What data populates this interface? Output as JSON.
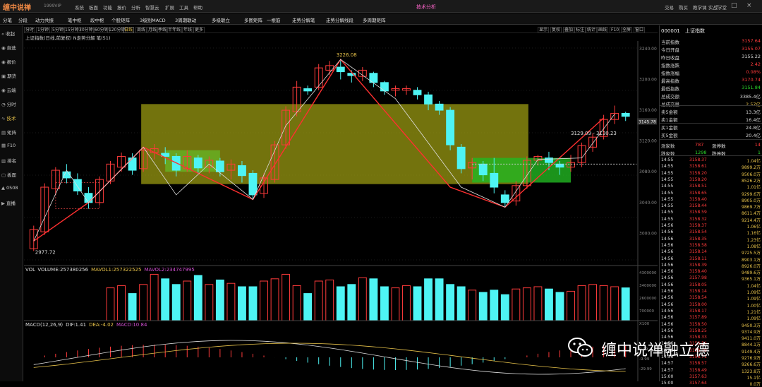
{
  "app": {
    "logo": "缠中说禅",
    "version": "1999VIP",
    "title": "技术分析"
  },
  "menu": [
    "系统",
    "板面",
    "功能",
    "报价",
    "分析",
    "智慧云",
    "扩展",
    "工具",
    "帮助"
  ],
  "right_menu": [
    "交易",
    "购买",
    "教学课",
    "实战学堂"
  ],
  "toolbar": [
    "分笔",
    "分段",
    "动力共振",
    "笔中枢",
    "段中枢",
    "个股矩阵",
    "3级别MACD",
    "3周期联动",
    "多级联立",
    "多图矩阵",
    "一根筋",
    "走势分解笔",
    "走势分解线段",
    "多周期矩阵"
  ],
  "sidebar": [
    {
      "icon": "«",
      "label": "收起"
    },
    {
      "icon": "◉",
      "label": "自选"
    },
    {
      "icon": "◉",
      "label": "报价"
    },
    {
      "icon": "▣",
      "label": "期货"
    },
    {
      "icon": "◉",
      "label": "云端"
    },
    {
      "icon": "◔",
      "label": "分时"
    },
    {
      "icon": "∿",
      "label": "技术"
    },
    {
      "icon": "▤",
      "label": "矩阵"
    },
    {
      "icon": "▦",
      "label": "F10"
    },
    {
      "icon": "▥",
      "label": "排名"
    },
    {
      "icon": "▢",
      "label": "板面"
    },
    {
      "icon": "▲",
      "label": "0508"
    },
    {
      "icon": "▶",
      "label": "直播"
    }
  ],
  "periods": [
    "分时",
    "1分钟",
    "5分钟",
    "15分钟",
    "30分钟",
    "60分钟",
    "120分钟",
    "日线",
    "周线",
    "月线",
    "季线",
    "半年线",
    "年线",
    "更多"
  ],
  "period_active": "日线",
  "chart_tools": [
    "显示",
    "复权",
    "叠加",
    "标注",
    "统计",
    "画线",
    "F10",
    "全屏",
    "窗口"
  ],
  "chart_info": "上证指数(日线,前复权)  N走势分解 笔(51)",
  "price_labels": {
    "high": "3226.08",
    "low": "2977.72",
    "zs": "3129.09 - 3130.23",
    "last": "3145.78"
  },
  "price_axis": [
    "3240.00",
    "3200.00",
    "3160.00",
    "3120.00",
    "3080.00",
    "3040.00",
    "3000.00"
  ],
  "vol_info": {
    "label": "VOL",
    "volume": "VOLUME:257380256",
    "ma1": "MAVOL1:257322525",
    "ma2": "MAVOL2:234747995"
  },
  "vol_axis": [
    "4300000",
    "3400000",
    "2600000",
    "700000",
    "X100"
  ],
  "macd_info": {
    "label": "MACD(12,26,9)",
    "dif": "DIF:1.41",
    "dea": "DEA:-4.02",
    "macd": "MACD:10.84"
  },
  "macd_axis": [
    "9.99",
    "-9.99",
    "-29.99"
  ],
  "chart_data": {
    "type": "candlestick",
    "up_color": "#ff3b3b",
    "down_color": "#4ef4f4",
    "candles": [
      [
        2980,
        3005,
        2977,
        3010
      ],
      [
        3002,
        3060,
        2998,
        3065
      ],
      [
        3058,
        3082,
        3050,
        3086
      ],
      [
        3080,
        3072,
        3065,
        3090
      ],
      [
        3070,
        3055,
        3050,
        3078
      ],
      [
        3052,
        3040,
        3032,
        3060
      ],
      [
        3040,
        3070,
        3036,
        3074
      ],
      [
        3068,
        3090,
        3064,
        3094
      ],
      [
        3086,
        3100,
        3080,
        3105
      ],
      [
        3098,
        3082,
        3076,
        3104
      ],
      [
        3084,
        3108,
        3080,
        3112
      ],
      [
        3105,
        3110,
        3096,
        3116
      ],
      [
        3104,
        3100,
        3090,
        3112
      ],
      [
        3100,
        3082,
        3074,
        3104
      ],
      [
        3084,
        3100,
        3080,
        3108
      ],
      [
        3098,
        3085,
        3078,
        3102
      ],
      [
        3086,
        3095,
        3078,
        3100
      ],
      [
        3094,
        3080,
        3074,
        3098
      ],
      [
        3082,
        3090,
        3070,
        3096
      ],
      [
        3088,
        3075,
        3066,
        3094
      ],
      [
        3078,
        3050,
        3044,
        3082
      ],
      [
        3052,
        3072,
        3046,
        3078
      ],
      [
        3070,
        3115,
        3066,
        3120
      ],
      [
        3115,
        3160,
        3110,
        3165
      ],
      [
        3158,
        3190,
        3152,
        3198
      ],
      [
        3188,
        3185,
        3180,
        3192
      ],
      [
        3190,
        3215,
        3186,
        3220
      ],
      [
        3212,
        3218,
        3206,
        3224
      ],
      [
        3216,
        3210,
        3200,
        3226
      ],
      [
        3208,
        3205,
        3196,
        3212
      ],
      [
        3204,
        3212,
        3198,
        3216
      ],
      [
        3208,
        3196,
        3190,
        3210
      ],
      [
        3196,
        3185,
        3180,
        3198
      ],
      [
        3186,
        3188,
        3178,
        3192
      ],
      [
        3186,
        3188,
        3180,
        3192
      ],
      [
        3186,
        3180,
        3174,
        3190
      ],
      [
        3180,
        3168,
        3160,
        3184
      ],
      [
        3168,
        3160,
        3154,
        3172
      ],
      [
        3160,
        3115,
        3108,
        3164
      ],
      [
        3112,
        3084,
        3078,
        3116
      ],
      [
        3085,
        3092,
        3070,
        3098
      ],
      [
        3090,
        3076,
        3068,
        3094
      ],
      [
        3078,
        3060,
        3052,
        3098
      ],
      [
        3050,
        3040,
        3034,
        3056
      ],
      [
        3042,
        3062,
        3036,
        3068
      ],
      [
        3062,
        3095,
        3058,
        3100
      ],
      [
        3095,
        3100,
        3088,
        3102
      ],
      [
        3098,
        3092,
        3082,
        3106
      ],
      [
        3090,
        3086,
        3076,
        3094
      ],
      [
        3086,
        3092,
        3080,
        3102
      ],
      [
        3092,
        3114,
        3086,
        3118
      ],
      [
        3112,
        3125,
        3106,
        3130
      ],
      [
        3126,
        3148,
        3122,
        3154
      ],
      [
        3148,
        3156,
        3142,
        3166
      ],
      [
        3156,
        3152,
        3146,
        3158
      ]
    ],
    "volume": [
      0,
      0,
      0,
      0,
      0,
      0,
      0,
      2.9,
      3.1,
      2.4,
      3.2,
      4.1,
      3.7,
      3.2,
      3.5,
      4.0,
      3.2,
      3.6,
      3.3,
      3.0,
      3.0,
      3.5,
      3.7,
      4.1,
      3.1,
      2.4,
      3.5,
      3.6,
      3.0,
      3.2,
      3.8,
      3.7,
      3.0,
      2.9,
      3.1,
      3.0,
      3.7,
      3.7,
      3.2,
      3.0,
      2.7,
      2.5,
      2.7,
      2.3,
      2.8,
      2.9,
      3.0,
      2.8,
      2.5,
      2.6,
      3.1,
      3.2,
      3.1,
      3.0,
      2.9
    ],
    "ylim": [
      2960,
      3250
    ]
  },
  "quote": {
    "code": "000001",
    "name": "上证指数",
    "rows": [
      {
        "label": "当前指数",
        "value": "3157.64",
        "c": "red"
      },
      {
        "label": "今日开盘",
        "value": "3155.07",
        "c": "red"
      },
      {
        "label": "昨日收盘",
        "value": "3155.22",
        "c": "wht"
      },
      {
        "label": "指数涨跌",
        "value": "2.42",
        "c": "red"
      },
      {
        "label": "指数涨幅",
        "value": "0.08%",
        "c": "red"
      },
      {
        "label": "最高指数",
        "value": "3170.74",
        "c": "red"
      },
      {
        "label": "最低指数",
        "value": "3151.84",
        "c": "grn"
      },
      {
        "label": "总成交额",
        "value": "3385.4亿",
        "c": "wht"
      },
      {
        "label": "总成交量",
        "value": "2.57亿",
        "c": "yel"
      },
      {
        "label": "卖5金额",
        "value": "13.3亿",
        "c": "wht"
      },
      {
        "label": "卖1金额",
        "value": "16.4亿",
        "c": "wht"
      },
      {
        "label": "买1金额",
        "value": "24.8亿",
        "c": "wht"
      },
      {
        "label": "买5金额",
        "value": "20.4亿",
        "c": "wht"
      }
    ],
    "counts": [
      {
        "l1": "涨家数",
        "v1": "787",
        "c1": "red",
        "l2": "涨停数",
        "v2": "14",
        "c2": "red"
      },
      {
        "l1": "跌家数",
        "v1": "1298",
        "c1": "grn",
        "l2": "跌停数",
        "v2": "1",
        "c2": "grn"
      }
    ]
  },
  "ticks": [
    [
      "14:55",
      "3158.37",
      "1.04亿"
    ],
    [
      "14:55",
      "3158.61",
      "9899.2万"
    ],
    [
      "14:55",
      "3158.20",
      "9506.0万"
    ],
    [
      "14:55",
      "3158.20",
      "8526.2万"
    ],
    [
      "14:55",
      "3158.51",
      "1.01亿"
    ],
    [
      "14:55",
      "3158.65",
      "9299.6万"
    ],
    [
      "14:55",
      "3158.40",
      "8905.0万"
    ],
    [
      "14:55",
      "3158.44",
      "9869.7万"
    ],
    [
      "14:55",
      "3158.59",
      "8611.4万"
    ],
    [
      "14:55",
      "3158.32",
      "9214.4万"
    ],
    [
      "14:56",
      "3158.37",
      "1.06亿"
    ],
    [
      "14:56",
      "3158.54",
      "1.16亿"
    ],
    [
      "14:56",
      "3158.35",
      "1.23亿"
    ],
    [
      "14:56",
      "3158.58",
      "1.08亿"
    ],
    [
      "14:56",
      "3158.14",
      "9725.5万"
    ],
    [
      "14:56",
      "3158.11",
      "8903.1万"
    ],
    [
      "14:56",
      "3158.39",
      "8926.0万"
    ],
    [
      "14:56",
      "3158.40",
      "9489.6万"
    ],
    [
      "14:56",
      "3157.98",
      "9365.1万"
    ],
    [
      "14:56",
      "3158.05",
      "1.04亿"
    ],
    [
      "14:56",
      "3158.14",
      "1.09亿"
    ],
    [
      "14:56",
      "3158.54",
      "1.09亿"
    ],
    [
      "14:56",
      "3158.00",
      "1.00亿"
    ],
    [
      "14:56",
      "3158.17",
      "1.21亿"
    ],
    [
      "14:56",
      "3157.89",
      "1.09亿"
    ],
    [
      "14:56",
      "3158.50",
      "9450.3万"
    ],
    [
      "14:56",
      "3158.25",
      "9374.9万"
    ],
    [
      "14:56",
      "3158.33",
      "9411.0万"
    ],
    [
      "14:56",
      "3158.54",
      "8844.1万"
    ],
    [
      "14:56",
      "3158.79",
      "9149.4万"
    ],
    [
      "14:56",
      "3158.71",
      "9276.9万"
    ],
    [
      "14:57",
      "3158.57",
      "9266.6万"
    ],
    [
      "14:57",
      "3158.49",
      "1323.8万"
    ],
    [
      "15:00",
      "3157.63",
      "15.1亿"
    ],
    [
      "15:00",
      "3157.64",
      "0.0万"
    ]
  ],
  "watermark": "缠中说禅融立德"
}
